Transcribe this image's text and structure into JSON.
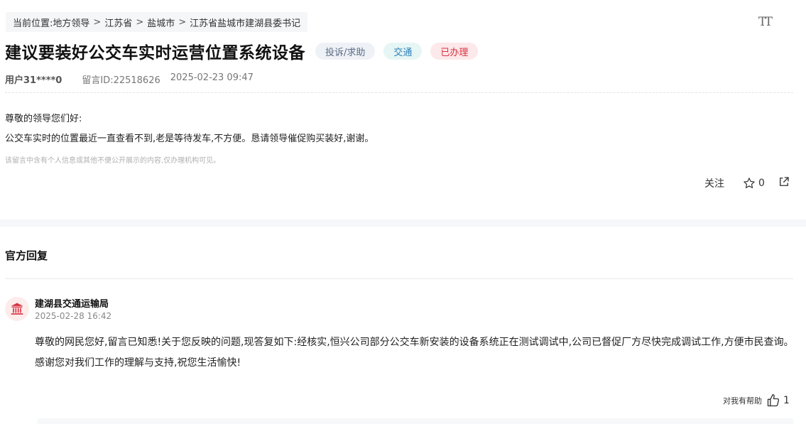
{
  "breadcrumb": {
    "prefix": "当前位置:",
    "items": [
      "地方领导",
      "江苏省",
      "盐城市",
      "江苏省盐城市建湖县委书记"
    ],
    "separator": ">"
  },
  "toolbar": {
    "font_size_icon": "font-size-icon"
  },
  "message": {
    "title": "建议要装好公交车实时运营位置系统设备",
    "tags": {
      "category": "投诉/求助",
      "topic": "交通",
      "status": "已办理"
    },
    "user": "用户31****0",
    "message_id": "留言ID:22518626",
    "datetime": "2025-02-23 09:47",
    "greeting": "尊敬的领导您们好:",
    "content": "公交车实时的位置最近一直查看不到,老是等待发车,不方便。恳请领导催促购买装好,谢谢。",
    "privacy_notice": "该留言中含有个人信息或其他不便公开展示的内容,仅办理机构可见。"
  },
  "actions": {
    "follow_label": "关注",
    "star_count": "0"
  },
  "official_reply": {
    "heading": "官方回复",
    "department": "建湖县交通运输局",
    "date": "2025-02-28 16:42",
    "content": "尊敬的网民您好,留言已知悉!关于您反映的问题,现答复如下:经核实,恒兴公司部分公交车新安装的设备系统正在测试调试中,公司已督促厂方尽快完成调试工作,方便市民查询。感谢您对我们工作的理解与支持,祝您生活愉快!",
    "helpful_label": "对我有帮助",
    "helpful_count": "1"
  },
  "colors": {
    "tag_status": "#d8313f",
    "tag_topic": "#2d7fb8",
    "tag_category": "#5b6b86",
    "avatar_icon": "#d8313f"
  }
}
